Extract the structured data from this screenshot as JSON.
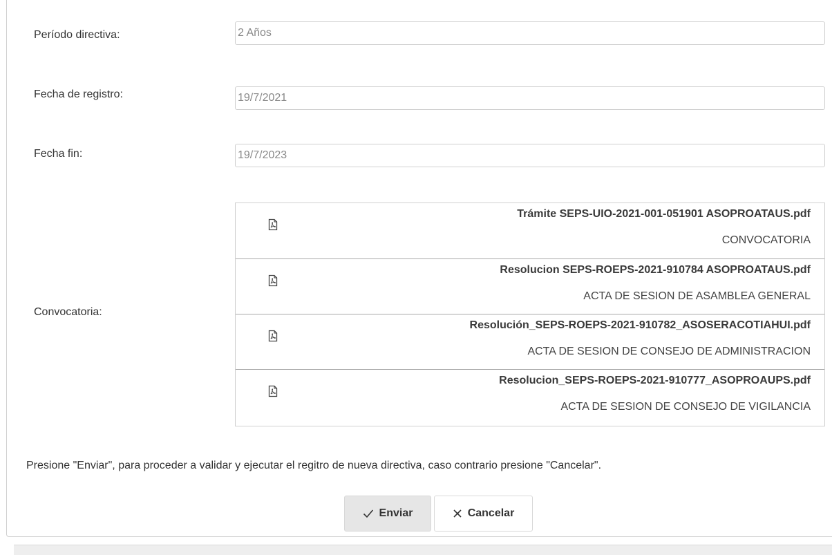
{
  "form": {
    "periodo": {
      "label": "Período directiva:",
      "value": "2 Años"
    },
    "fecha_registro": {
      "label": "Fecha de registro:",
      "value": "19/7/2021"
    },
    "fecha_fin": {
      "label": "Fecha fin:",
      "value": "19/7/2023"
    },
    "convocatoria": {
      "label": "Convocatoria:",
      "documents": [
        {
          "name": "Trámite SEPS-UIO-2021-001-051901 ASOPROATAUS.pdf",
          "type": "CONVOCATORIA",
          "icon": "pdf-file-icon"
        },
        {
          "name": "Resolucion SEPS-ROEPS-2021-910784 ASOPROATAUS.pdf",
          "type": "ACTA DE SESION DE ASAMBLEA GENERAL",
          "icon": "pdf-file-icon"
        },
        {
          "name": "Resolución_SEPS-ROEPS-2021-910782_ASOSERACOTIAHUI.pdf",
          "type": "ACTA DE SESION DE CONSEJO DE ADMINISTRACION",
          "icon": "pdf-file-icon"
        },
        {
          "name": "Resolucion_SEPS-ROEPS-2021-910777_ASOPROAUPS.pdf",
          "type": "ACTA DE SESION DE CONSEJO DE VIGILANCIA",
          "icon": "pdf-file-icon"
        }
      ]
    },
    "notice": "Presione \"Enviar\", para proceder a validar y ejecutar el regitro de nueva directiva, caso contrario presione \"Cancelar\".",
    "buttons": {
      "send_label": "Enviar",
      "send_icon": "check-icon",
      "cancel_label": "Cancelar",
      "cancel_icon": "close-icon"
    }
  }
}
